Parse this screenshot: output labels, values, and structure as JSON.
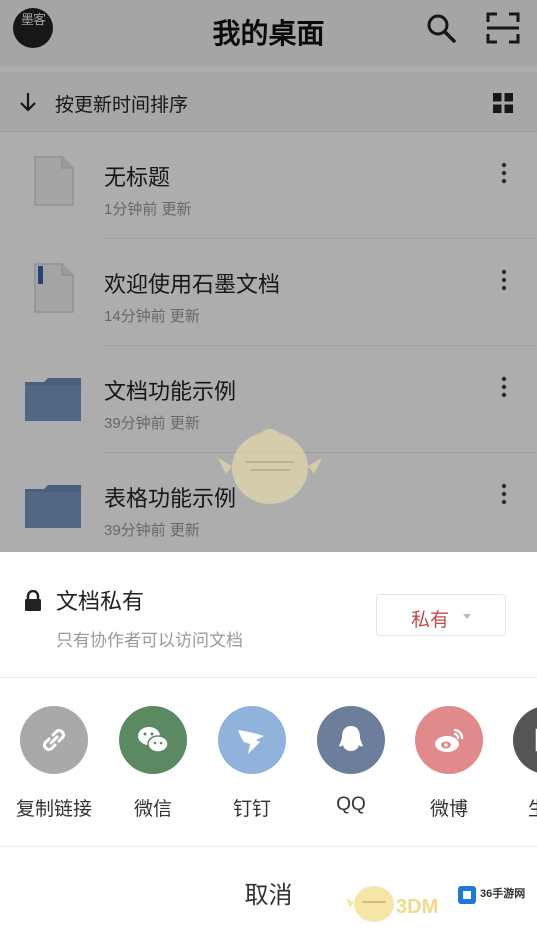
{
  "header": {
    "avatar_text": "墨客",
    "title": "我的桌面",
    "search_icon": "search-icon",
    "scan_icon": "scan-icon"
  },
  "sort_bar": {
    "label": "按更新时间排序",
    "arrow_icon": "arrow-down-icon",
    "view_icon": "grid-view-icon"
  },
  "files": [
    {
      "name": "无标题",
      "meta": "1分钟前  更新",
      "type": "document"
    },
    {
      "name": "欢迎使用石墨文档",
      "meta": "14分钟前  更新",
      "type": "document"
    },
    {
      "name": "文档功能示例",
      "meta": "39分钟前  更新",
      "type": "folder"
    },
    {
      "name": "表格功能示例",
      "meta": "39分钟前  更新",
      "type": "folder"
    }
  ],
  "share_sheet": {
    "permission": {
      "title": "文档私有",
      "description": "只有协作者可以访问文档",
      "selected": "私有"
    },
    "targets": [
      {
        "label": "复制链接",
        "color": "#a9a9a9",
        "icon": "link-icon"
      },
      {
        "label": "微信",
        "color": "#5b8a62",
        "icon": "wechat-icon"
      },
      {
        "label": "钉钉",
        "color": "#8fb3db",
        "icon": "dingtalk-icon"
      },
      {
        "label": "QQ",
        "color": "#6c7e99",
        "icon": "qq-icon"
      },
      {
        "label": "微博",
        "color": "#e08a8c",
        "icon": "weibo-icon"
      },
      {
        "label": "生成",
        "color": "#555555",
        "icon": "generate-icon"
      }
    ],
    "cancel_label": "取消"
  },
  "watermark": {
    "text": "3DM",
    "logo_text": "36手游网"
  },
  "colors": {
    "accent_red": "#c14b50",
    "folder_blue": "#6f8db8"
  }
}
